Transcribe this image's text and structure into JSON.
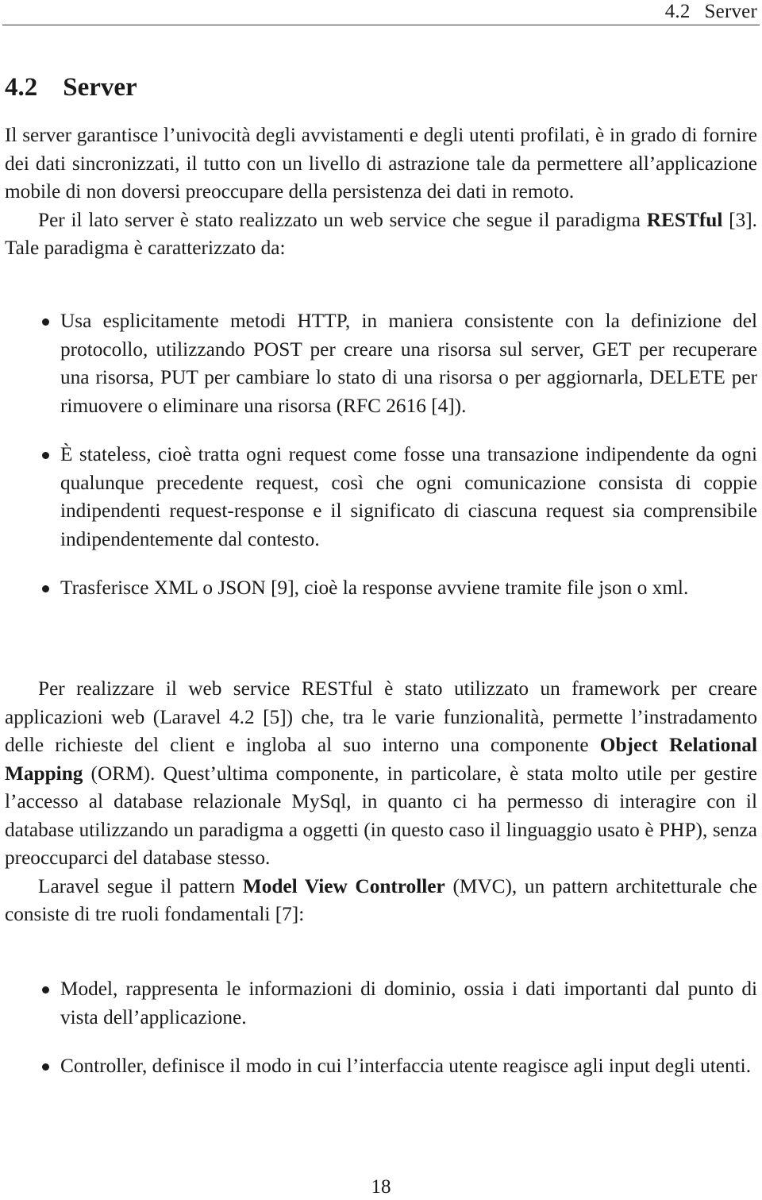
{
  "header": {
    "section_number": "4.2",
    "section_name": "Server"
  },
  "section": {
    "number": "4.2",
    "title": "Server"
  },
  "paragraphs": {
    "intro": "Il server garantisce l’univocità degli avvistamenti e degli utenti profilati, è in grado di fornire dei dati sincronizzati, il tutto con un livello di astrazione tale da permettere all’applicazione mobile di non doversi preoccupare della persistenza dei dati in remoto.",
    "restful_before": "Per il lato server è stato realizzato un web service che segue il paradigma ",
    "restful_bold": "RESTful",
    "restful_after": " [3]. Tale paradigma è caratterizzato da:",
    "framework_before": "Per realizzare il web service RESTful è stato utilizzato un framework per creare applicazioni web (Laravel 4.2 [5]) che, tra le varie funzionalità, permette l’instradamento delle richieste del client e ingloba al suo interno una componente ",
    "framework_bold": "Object Relational Mapping",
    "framework_after": " (ORM). Quest’ultima componente, in particolare, è stata molto utile per gestire l’accesso al database relazionale MySql, in quanto ci ha permesso di interagire con il database utilizzando un paradigma a oggetti (in questo caso il linguaggio usato è PHP), senza preoccuparci del database stesso.",
    "mvc_before": "Laravel segue il pattern ",
    "mvc_bold": "Model View Controller",
    "mvc_after": " (MVC), un pattern architetturale che consiste di tre ruoli fondamentali [7]:"
  },
  "rest_features": [
    "Usa esplicitamente metodi HTTP, in maniera consistente con la definizione del protocollo, utilizzando POST per creare una risorsa sul server, GET per recuperare una risorsa, PUT per cambiare lo stato di una risorsa o per aggiornarla, DELETE per rimuovere o eliminare una risorsa (RFC 2616 [4]).",
    "È stateless, cioè tratta ogni request come fosse una transazione indipendente da ogni qualunque precedente request, così che ogni comunicazione consista di coppie indipendenti request-response e il significato di ciascuna request sia comprensibile indipendentemente dal contesto.",
    "Trasferisce XML o JSON [9], cioè la response avviene tramite file json o xml."
  ],
  "mvc_roles": [
    "Model, rappresenta le informazioni di dominio, ossia i dati importanti dal punto di vista dell’applicazione.",
    "Controller, definisce il modo in cui l’interfaccia utente reagisce agli input degli utenti."
  ],
  "footer": {
    "page_number": "18"
  }
}
